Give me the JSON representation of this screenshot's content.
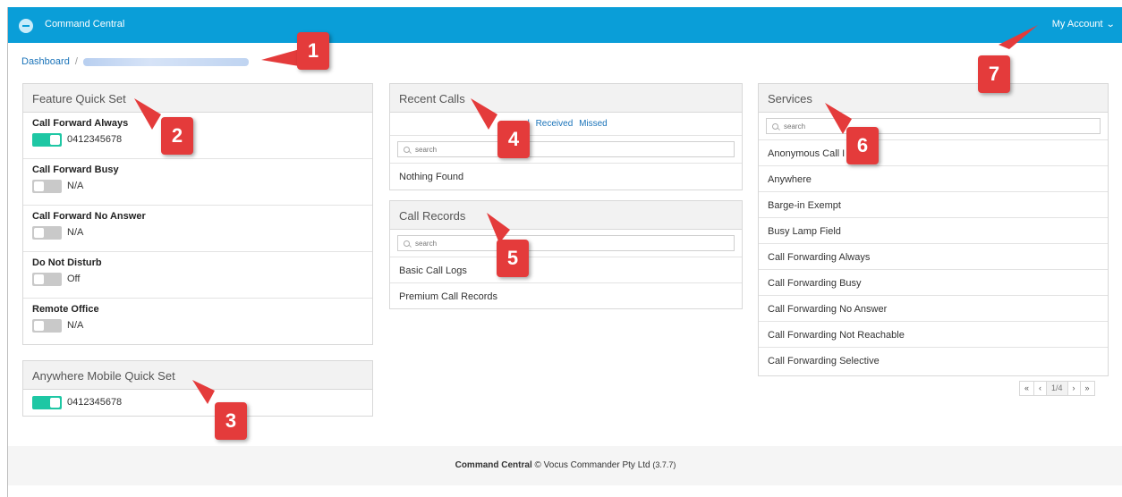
{
  "app": {
    "title": "Command Central",
    "account_label": "My Account"
  },
  "breadcrumb": {
    "home": "Dashboard",
    "separator": "/"
  },
  "feature_quick_set": {
    "title": "Feature Quick Set",
    "items": [
      {
        "label": "Call Forward Always",
        "value": "0412345678",
        "on": true
      },
      {
        "label": "Call Forward Busy",
        "value": "N/A",
        "on": false
      },
      {
        "label": "Call Forward No Answer",
        "value": "N/A",
        "on": false
      },
      {
        "label": "Do Not Disturb",
        "value": "Off",
        "on": false
      },
      {
        "label": "Remote Office",
        "value": "N/A",
        "on": false
      }
    ]
  },
  "anywhere_quick_set": {
    "title": "Anywhere Mobile Quick Set",
    "value": "0412345678",
    "on": true
  },
  "recent_calls": {
    "title": "Recent Calls",
    "filters": [
      "d",
      "Received",
      "Missed"
    ],
    "search_placeholder": "search",
    "empty_text": "Nothing Found"
  },
  "call_records": {
    "title": "Call Records",
    "search_placeholder": "search",
    "items": [
      "Basic Call Logs",
      "Premium Call Records"
    ]
  },
  "services": {
    "title": "Services",
    "search_placeholder": "search",
    "items": [
      "Anonymous Call I",
      "Anywhere",
      "Barge-in Exempt",
      "Busy Lamp Field",
      "Call Forwarding Always",
      "Call Forwarding Busy",
      "Call Forwarding No Answer",
      "Call Forwarding Not Reachable",
      "Call Forwarding Selective"
    ],
    "pager": {
      "first": "«",
      "prev": "‹",
      "page": "1/4",
      "next": "›",
      "last": "»"
    }
  },
  "footer": {
    "brand": "Command Central",
    "text": "© Vocus Commander Pty Ltd",
    "version": "(3.7.7)"
  },
  "callouts": [
    "1",
    "2",
    "3",
    "4",
    "5",
    "6",
    "7"
  ],
  "colors": {
    "topbar": "#0a9ed8",
    "toggle_on": "#1ec7a4",
    "callout": "#e43b3b",
    "link": "#1a73b9"
  }
}
